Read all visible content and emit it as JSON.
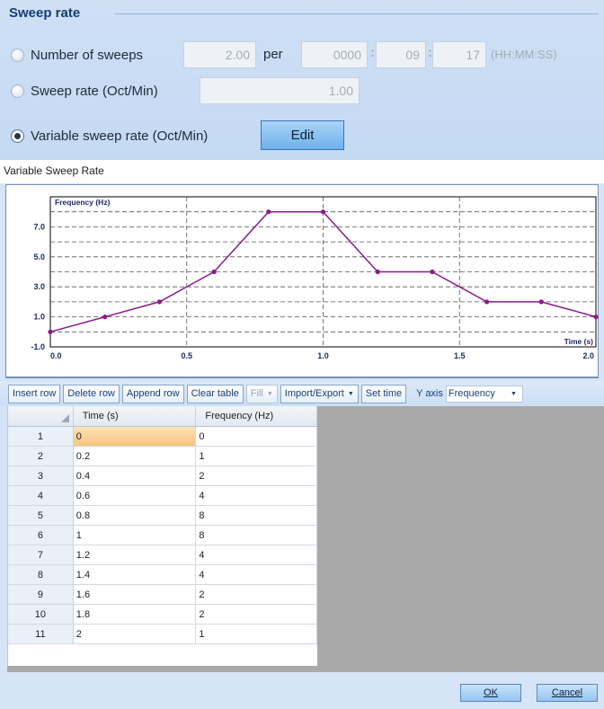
{
  "sweep_group": {
    "title": "Sweep rate",
    "option_sweeps_label": "Number of sweeps",
    "sweeps_value": "2.00",
    "per_label": "per",
    "time_hh": "0000",
    "time_mm": "09",
    "time_ss": "17",
    "time_separator": ":",
    "time_format_hint": "(HH:MM:SS)",
    "option_rate_label": "Sweep rate (Oct/Min)",
    "rate_value": "1.00",
    "option_variable_label": "Variable sweep rate (Oct/Min)",
    "edit_label": "Edit",
    "selected_option": "variable"
  },
  "chart_caption": "Variable Sweep Rate",
  "chart_data": {
    "type": "line",
    "ylabel": "Frequency (Hz)",
    "xlabel": "Time (s)",
    "xlim": [
      0,
      2.0
    ],
    "ylim": [
      -1.0,
      9.0
    ],
    "x_ticks": [
      "0.0",
      "0.5",
      "1.0",
      "1.5",
      "2.0"
    ],
    "y_ticks": [
      "-1.0",
      "1.0",
      "3.0",
      "5.0",
      "7.0"
    ],
    "series": [
      {
        "color": "#8b1a8b",
        "x": [
          0,
          0.2,
          0.4,
          0.6,
          0.8,
          1.0,
          1.2,
          1.4,
          1.6,
          1.8,
          2.0
        ],
        "y": [
          0,
          1,
          2,
          4,
          8,
          8,
          4,
          4,
          2,
          2,
          1
        ]
      }
    ],
    "grid": true
  },
  "toolbar": {
    "insert_row": "Insert row",
    "delete_row": "Delete row",
    "append_row": "Append row",
    "clear_table": "Clear table",
    "fill": "Fill",
    "import_export": "Import/Export",
    "set_time": "Set time",
    "y_axis_label": "Y axis",
    "y_axis_value": "Frequency"
  },
  "table": {
    "headers": [
      "Time (s)",
      "Frequency (Hz)"
    ],
    "rows": [
      {
        "n": "1",
        "time": "0",
        "freq": "0"
      },
      {
        "n": "2",
        "time": "0.2",
        "freq": "1"
      },
      {
        "n": "3",
        "time": "0.4",
        "freq": "2"
      },
      {
        "n": "4",
        "time": "0.6",
        "freq": "4"
      },
      {
        "n": "5",
        "time": "0.8",
        "freq": "8"
      },
      {
        "n": "6",
        "time": "1",
        "freq": "8"
      },
      {
        "n": "7",
        "time": "1.2",
        "freq": "4"
      },
      {
        "n": "8",
        "time": "1.4",
        "freq": "4"
      },
      {
        "n": "9",
        "time": "1.6",
        "freq": "2"
      },
      {
        "n": "10",
        "time": "1.8",
        "freq": "2"
      },
      {
        "n": "11",
        "time": "2",
        "freq": "1"
      }
    ]
  },
  "footer": {
    "ok_label": "OK",
    "cancel_label": "Cancel"
  }
}
